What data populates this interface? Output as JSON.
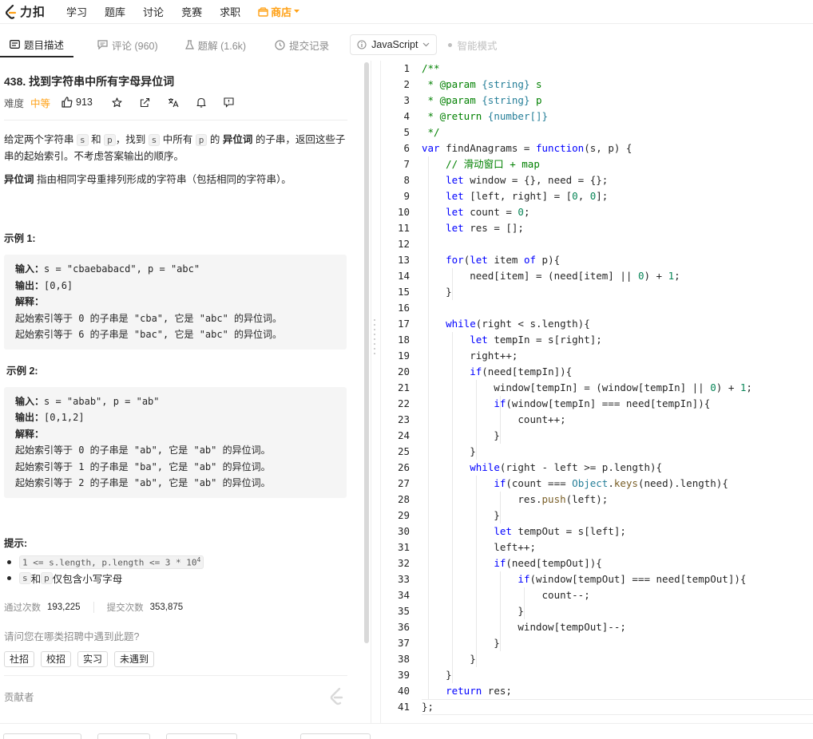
{
  "nav": {
    "logo": "力扣",
    "items": [
      "学习",
      "题库",
      "讨论",
      "竞赛",
      "求职"
    ],
    "store": "商店",
    "colors": {
      "store": "#ffa116"
    }
  },
  "tabs": [
    {
      "label": "题目描述",
      "icon": "description-icon"
    },
    {
      "label": "评论 (960)",
      "icon": "comment-icon"
    },
    {
      "label": "题解 (1.6k)",
      "icon": "flask-icon"
    },
    {
      "label": "提交记录",
      "icon": "clock-icon"
    }
  ],
  "editor_toolbar": {
    "language": "JavaScript",
    "smart_mode": "智能模式"
  },
  "problem": {
    "title": "438. 找到字符串中所有字母异位词",
    "difficulty_label": "难度",
    "difficulty": "中等",
    "likes": "913",
    "desc": {
      "p1_a": "给定两个字符串 ",
      "s": "s",
      "p1_b": " 和 ",
      "p": "p",
      "p1_c": "，找到 ",
      "p1_d": " 中所有 ",
      "p1_e": " 的 ",
      "term": "异位词",
      "p1_f": " 的子串，返回这些子串的起始索引。不考虑答案输出的顺序。",
      "p2_term": "异位词",
      "p2_rest": " 指由相同字母重排列形成的字符串（包括相同的字符串）。"
    },
    "examples": [
      {
        "title": "示例 1:",
        "input_label": "输入：",
        "input": "s = \"cbaebabacd\", p = \"abc\"",
        "output_label": "输出：",
        "output": "[0,6]",
        "explain_label": "解释：",
        "explain": [
          "起始索引等于 0 的子串是 \"cba\", 它是 \"abc\" 的异位词。",
          "起始索引等于 6 的子串是 \"bac\", 它是 \"abc\" 的异位词。"
        ]
      },
      {
        "title": "示例 2:",
        "input_label": "输入：",
        "input": "s = \"abab\", p = \"ab\"",
        "output_label": "输出：",
        "output": "[0,1,2]",
        "explain_label": "解释：",
        "explain": [
          "起始索引等于 0 的子串是 \"ab\", 它是 \"ab\" 的异位词。",
          "起始索引等于 1 的子串是 \"ba\", 它是 \"ab\" 的异位词。",
          "起始索引等于 2 的子串是 \"ab\", 它是 \"ab\" 的异位词。"
        ]
      }
    ],
    "hints_title": "提示:",
    "hint1_code": "1 <= s.length, p.length <= 3 * 10",
    "hint1_sup": "4",
    "hint2_s": "s",
    "hint2_mid": " 和 ",
    "hint2_p": "p",
    "hint2_rest": " 仅包含小写字母",
    "stats": {
      "accepted_label": "通过次数",
      "accepted": "193,225",
      "submissions_label": "提交次数",
      "submissions": "353,875"
    },
    "question": "请问您在哪类招聘中遇到此题?",
    "chips": [
      "社招",
      "校招",
      "实习",
      "未遇到"
    ],
    "contributors": "贡献者"
  },
  "code": [
    "/**",
    " * @param {string} s",
    " * @param {string} p",
    " * @return {number[]}",
    " */",
    "var findAnagrams = function(s, p) {",
    "    // 滑动窗口 + map",
    "    let window = {}, need = {};",
    "    let [left, right] = [0, 0];",
    "    let count = 0;",
    "    let res = [];",
    "",
    "    for(let item of p){",
    "        need[item] = (need[item] || 0) + 1;",
    "    }",
    "",
    "    while(right < s.length){",
    "        let tempIn = s[right];",
    "        right++;",
    "        if(need[tempIn]){",
    "            window[tempIn] = (window[tempIn] || 0) + 1;",
    "            if(window[tempIn] === need[tempIn]){",
    "                count++;",
    "            }",
    "        }",
    "        while(right - left >= p.length){",
    "            if(count === Object.keys(need).length){",
    "                res.push(left);",
    "            }",
    "            let tempOut = s[left];",
    "            left++;",
    "            if(need[tempOut]){",
    "                if(window[tempOut] === need[tempOut]){",
    "                    count--;",
    "                }",
    "                window[tempOut]--;",
    "            }",
    "        }",
    "    }",
    "    return res;",
    "};"
  ]
}
